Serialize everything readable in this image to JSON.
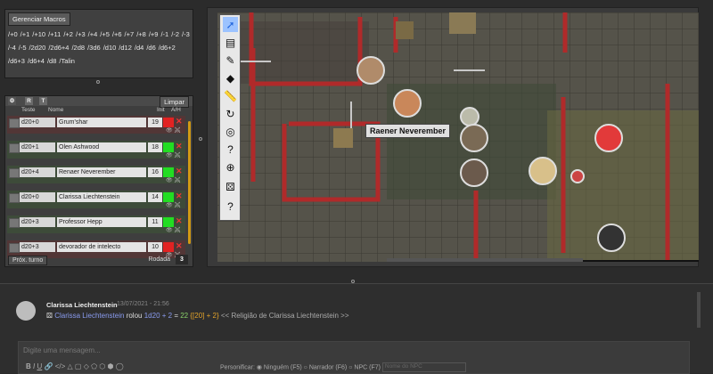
{
  "macros": {
    "manage_label": "Gerenciar Macros",
    "items": [
      "/+0",
      "/+1",
      "/+10",
      "/+11",
      "/+2",
      "/+3",
      "/+4",
      "/+5",
      "/+6",
      "/+7",
      "/+8",
      "/+9",
      "/-1",
      "/-2",
      "/-3",
      "/-4",
      "/-5",
      "/2d20",
      "/2d6+4",
      "/2d8",
      "/3d6",
      "/d10",
      "/d12",
      "/d4",
      "/d6",
      "/d6+2",
      "/d6+3",
      "/d6+4",
      "/d8",
      "/Talin"
    ]
  },
  "initiative": {
    "toolbar_r": "R",
    "toolbar_t": "T",
    "clear_label": "Limpar",
    "header_test": "Teste",
    "header_name": "Nome",
    "header_init": "Init",
    "header_ah": "A/H",
    "rows": [
      {
        "dice": "d20+0",
        "name": "Grum'shar",
        "init": "19",
        "status": "#e22222"
      },
      {
        "dice": "d20+1",
        "name": "Olen Ashwood",
        "init": "18",
        "status": "#22dd22"
      },
      {
        "dice": "d20+4",
        "name": "Renaer Neverember",
        "init": "16",
        "status": "#22dd22"
      },
      {
        "dice": "d20+0",
        "name": "Clarissa Liechtenstein",
        "init": "14",
        "status": "#22dd22"
      },
      {
        "dice": "d20+3",
        "name": "Professor Hepp",
        "init": "11",
        "status": "#22dd22"
      },
      {
        "dice": "d20+3",
        "name": "devorador de intelecto",
        "init": "10",
        "status": "#e22222"
      }
    ],
    "next_turn_label": "Próx. turno",
    "round_label": "Rodada",
    "round_value": "3"
  },
  "map": {
    "tooltip": "Raener Neverember"
  },
  "chat": {
    "name": "Clarissa Liechtenstein",
    "time": "13/07/2021 - 21:56",
    "roller": "Clarissa Liechtenstein",
    "rolled": "rolou",
    "expr": "1d20 + 2",
    "eq": "=",
    "total": "22",
    "detail": "{[20] + 2}",
    "note": "<< Religião de Clarissa Liechtenstein >>",
    "placeholder": "Digite uma mensagem...",
    "personify_label": "Personificar:",
    "opt_none": "Ninguém (F5)",
    "opt_narrator": "Narrador (F6)",
    "opt_npc": "NPC (F7)",
    "npc_placeholder": "Nome do NPC"
  },
  "colors": {
    "accent": "#d29a14",
    "blue": "#5a8ae6"
  }
}
